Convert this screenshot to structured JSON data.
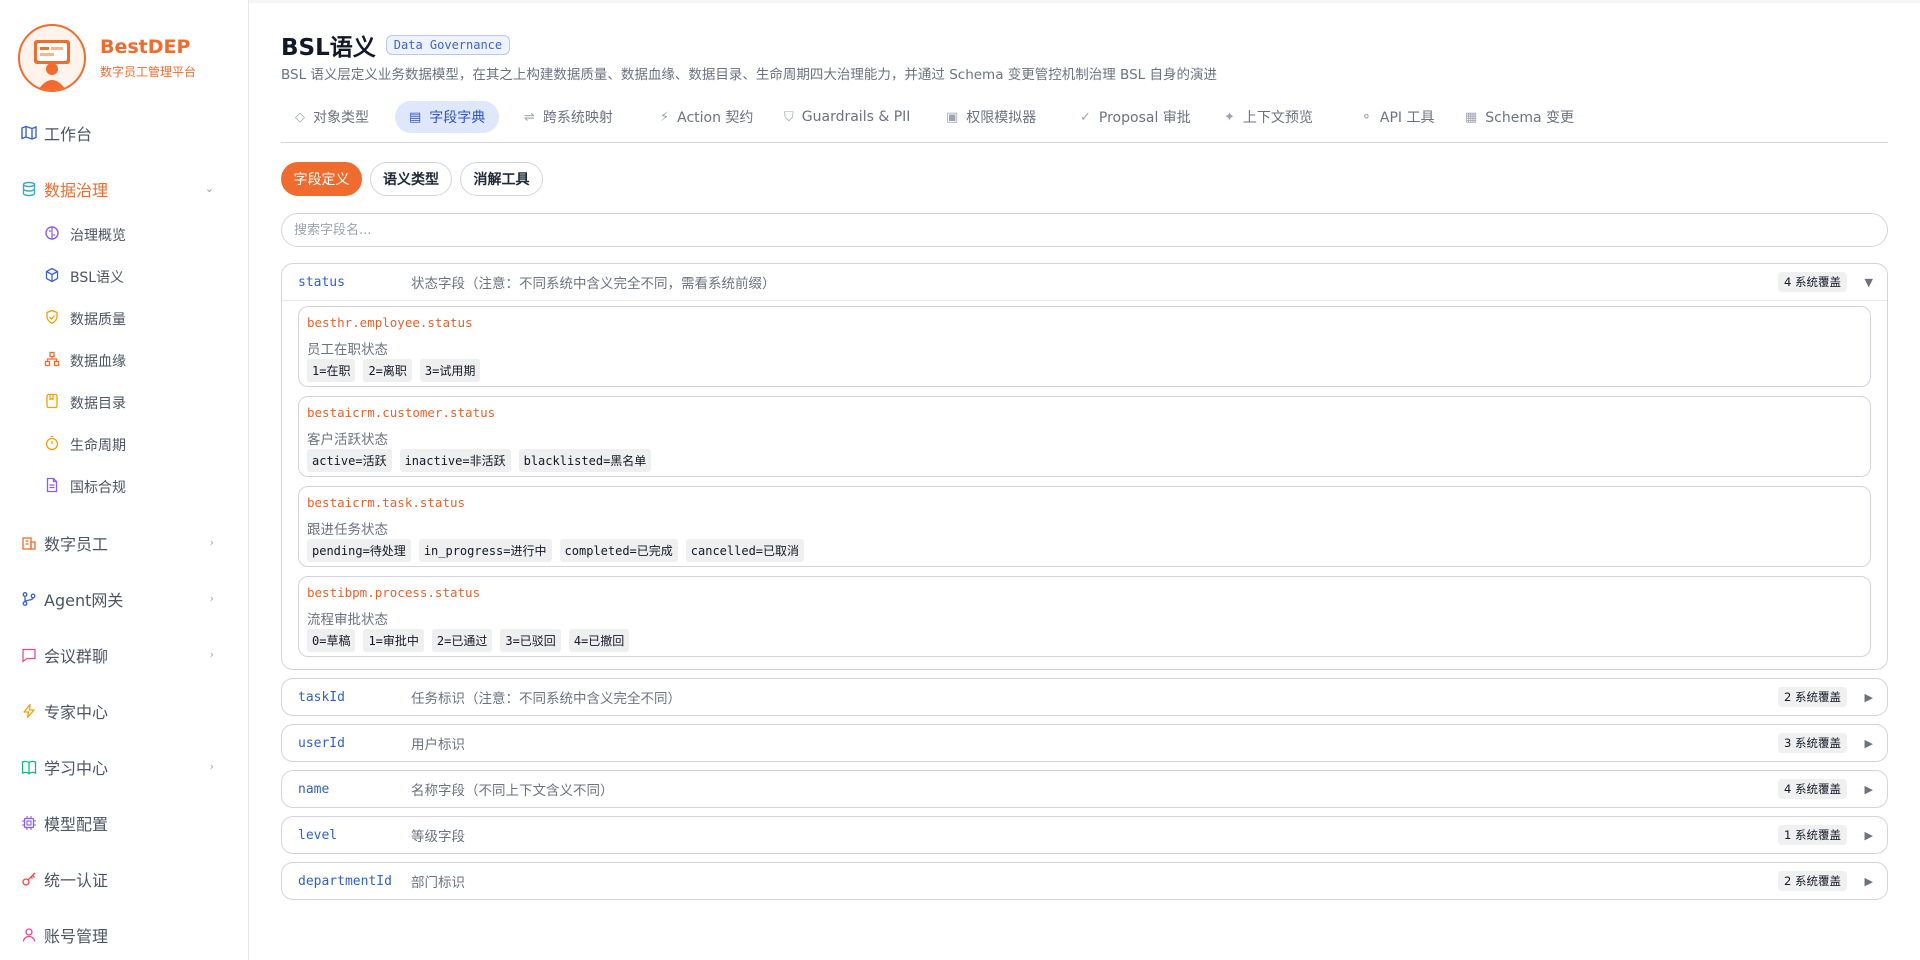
{
  "brand": {
    "name": "BestDEP",
    "subtitle": "数字员工管理平台"
  },
  "sidebar": {
    "items": [
      {
        "label": "工作台",
        "icon": "map-icon",
        "expandable": false
      },
      {
        "label": "数据治理",
        "icon": "database-icon",
        "expandable": true,
        "active": true
      },
      {
        "label": "数字员工",
        "icon": "building-icon",
        "expandable": true
      },
      {
        "label": "Agent网关",
        "icon": "git-branch-icon",
        "expandable": true
      },
      {
        "label": "会议群聊",
        "icon": "chat-icon",
        "expandable": true
      },
      {
        "label": "专家中心",
        "icon": "lightning-icon",
        "expandable": false
      },
      {
        "label": "学习中心",
        "icon": "book-icon",
        "expandable": true
      },
      {
        "label": "模型配置",
        "icon": "chip-icon",
        "expandable": false
      },
      {
        "label": "统一认证",
        "icon": "key-icon",
        "expandable": false
      },
      {
        "label": "账号管理",
        "icon": "user-icon",
        "expandable": false
      }
    ],
    "sub_items": [
      {
        "label": "治理概览",
        "icon": "brain-icon"
      },
      {
        "label": "BSL语义",
        "icon": "cube-icon"
      },
      {
        "label": "数据质量",
        "icon": "shield-check-icon"
      },
      {
        "label": "数据血缘",
        "icon": "network-icon"
      },
      {
        "label": "数据目录",
        "icon": "catalog-icon"
      },
      {
        "label": "生命周期",
        "icon": "timer-icon"
      },
      {
        "label": "国标合规",
        "icon": "document-icon"
      }
    ]
  },
  "header": {
    "title": "BSL语义",
    "badge": "Data Governance",
    "description": "BSL 语义层定义业务数据模型，在其之上构建数据质量、数据血缘、数据目录、生命周期四大治理能力，并通过 Schema 变更管控机制治理 BSL 自身的演进"
  },
  "tabs": [
    {
      "label": "对象类型",
      "icon": "◇"
    },
    {
      "label": "字段字典",
      "icon": "▤",
      "active": true
    },
    {
      "label": "跨系统映射",
      "icon": "⇌"
    },
    {
      "label": "Action 契约",
      "icon": "⚡"
    },
    {
      "label": "Guardrails & PII",
      "icon": "⛉"
    },
    {
      "label": "权限模拟器",
      "icon": "▣"
    },
    {
      "label": "Proposal 审批",
      "icon": "✓"
    },
    {
      "label": "上下文预览",
      "icon": "✦"
    },
    {
      "label": "API 工具",
      "icon": "⚬"
    },
    {
      "label": "Schema 变更",
      "icon": "▦"
    }
  ],
  "subtabs": [
    {
      "label": "字段定义",
      "active": true
    },
    {
      "label": "语义类型"
    },
    {
      "label": "消解工具"
    }
  ],
  "search": {
    "placeholder": "搜索字段名...",
    "value": ""
  },
  "fields": [
    {
      "name": "status",
      "description": "状态字段（注意：不同系统中含义完全不同，需看系统前缀）",
      "coverage": "4 系统覆盖",
      "arrow": "▼",
      "expanded": true,
      "systems": [
        {
          "path": "besthr.employee.status",
          "desc": "员工在职状态",
          "values": [
            "1=在职",
            "2=离职",
            "3=试用期"
          ]
        },
        {
          "path": "bestaicrm.customer.status",
          "desc": "客户活跃状态",
          "values": [
            "active=活跃",
            "inactive=非活跃",
            "blacklisted=黑名单"
          ]
        },
        {
          "path": "bestaicrm.task.status",
          "desc": "跟进任务状态",
          "values": [
            "pending=待处理",
            "in_progress=进行中",
            "completed=已完成",
            "cancelled=已取消"
          ]
        },
        {
          "path": "bestibpm.process.status",
          "desc": "流程审批状态",
          "values": [
            "0=草稿",
            "1=审批中",
            "2=已通过",
            "3=已驳回",
            "4=已撤回"
          ]
        }
      ]
    },
    {
      "name": "taskId",
      "description": "任务标识（注意：不同系统中含义完全不同）",
      "coverage": "2 系统覆盖",
      "arrow": "▶"
    },
    {
      "name": "userId",
      "description": "用户标识",
      "coverage": "3 系统覆盖",
      "arrow": "▶"
    },
    {
      "name": "name",
      "description": "名称字段（不同上下文含义不同）",
      "coverage": "4 系统覆盖",
      "arrow": "▶"
    },
    {
      "name": "level",
      "description": "等级字段",
      "coverage": "1 系统覆盖",
      "arrow": "▶"
    },
    {
      "name": "departmentId",
      "description": "部门标识",
      "coverage": "2 系统覆盖",
      "arrow": "▶"
    }
  ],
  "colors": {
    "accent": "#f06b2e",
    "link": "#2f5fd0",
    "active_tab_bg": "#dfe7fb"
  }
}
